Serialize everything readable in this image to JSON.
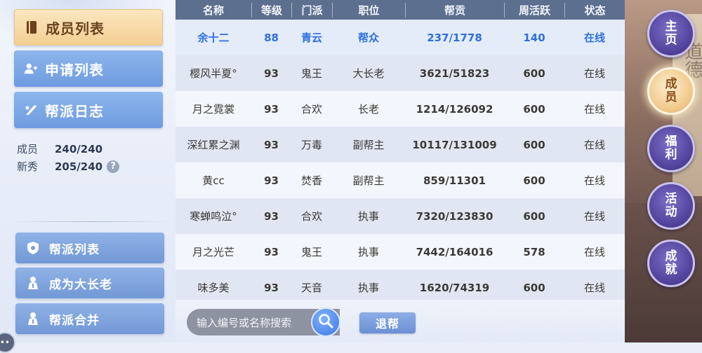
{
  "left": {
    "tabs": [
      {
        "label": "成员列表",
        "icon": "book-icon"
      },
      {
        "label": "申请列表",
        "icon": "add-user-icon"
      },
      {
        "label": "帮派日志",
        "icon": "quill-icon"
      }
    ],
    "stats": {
      "members_label": "成员",
      "members_value": "240/240",
      "newbies_label": "新秀",
      "newbies_value": "205/240",
      "help": "?"
    },
    "actions": [
      {
        "label": "帮派列表",
        "icon": "shield-icon"
      },
      {
        "label": "成为大长老",
        "icon": "elder-icon"
      },
      {
        "label": "帮派合并",
        "icon": "elder-icon"
      }
    ],
    "chat": "•••"
  },
  "table": {
    "headers": [
      "名称",
      "等级",
      "门派",
      "职位",
      "帮贡",
      "周活跃",
      "状态"
    ],
    "rows": [
      [
        "余十二",
        "88",
        "青云",
        "帮众",
        "237/1778",
        "140",
        "在线"
      ],
      [
        "樱风半夏°",
        "93",
        "鬼王",
        "大长老",
        "3621/51823",
        "600",
        "在线"
      ],
      [
        "月之霓裳",
        "93",
        "合欢",
        "长老",
        "1214/126092",
        "600",
        "在线"
      ],
      [
        "深红累之渊",
        "93",
        "万毒",
        "副帮主",
        "10117/131009",
        "600",
        "在线"
      ],
      [
        "黄cc",
        "93",
        "焚香",
        "副帮主",
        "859/11301",
        "600",
        "在线"
      ],
      [
        "寒蝉鸣泣°",
        "93",
        "合欢",
        "执事",
        "7320/123830",
        "600",
        "在线"
      ],
      [
        "月之光芒",
        "93",
        "鬼王",
        "执事",
        "7442/164016",
        "578",
        "在线"
      ],
      [
        "味多美",
        "93",
        "天音",
        "执事",
        "1620/74319",
        "600",
        "在线"
      ]
    ]
  },
  "footer": {
    "search_placeholder": "输入编号或名称搜索",
    "quit_label": "退帮"
  },
  "right": {
    "scroll_text": "道德",
    "nav": [
      {
        "label": "主页",
        "chars": [
          "主",
          "页"
        ],
        "active": false
      },
      {
        "label": "成员",
        "chars": [
          "成",
          "员"
        ],
        "active": true
      },
      {
        "label": "福利",
        "chars": [
          "福",
          "利"
        ],
        "active": false
      },
      {
        "label": "活动",
        "chars": [
          "活",
          "动"
        ],
        "active": false
      },
      {
        "label": "成就",
        "chars": [
          "成",
          "就"
        ],
        "active": false
      }
    ]
  },
  "colors": {
    "header_bg": "#5d6f8f",
    "self_row_text": "#2f6fe0",
    "active_tab": "#f3cf92",
    "nav_purple": "#4e3f98"
  }
}
